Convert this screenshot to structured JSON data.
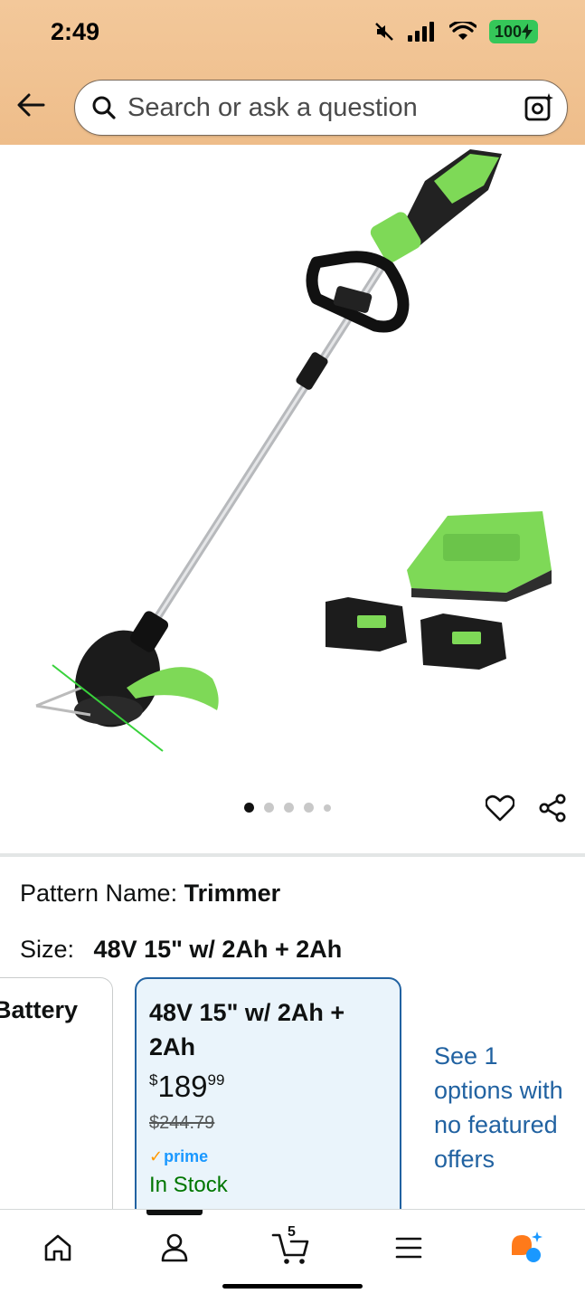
{
  "status_bar": {
    "time": "2:49",
    "battery": "100"
  },
  "header": {
    "search_placeholder": "Search or ask a question"
  },
  "gallery": {
    "dot_count": 5,
    "active_index": 0
  },
  "product": {
    "pattern_label": "Pattern Name:",
    "pattern_value": "Trimmer",
    "size_label": "Size:",
    "size_value": "48V 15\" w/ 2Ah + 2Ah",
    "options": [
      {
        "label": "Battery",
        "partial": true
      },
      {
        "title": "48V 15\" w/ 2Ah + 2Ah",
        "price_symbol": "$",
        "price_whole": "189",
        "price_fraction": "99",
        "list_price": "$244.79",
        "prime_label": "prime",
        "availability": "In Stock",
        "selected": true
      }
    ],
    "see_options_link": "See 1 options with no featured offers"
  },
  "bottom_nav": {
    "cart_count": "5",
    "tabs": [
      "home",
      "account",
      "cart",
      "menu",
      "rufus"
    ]
  },
  "colors": {
    "header_bg": "#f0c290",
    "accent_green": "#7ed957",
    "link_blue": "#2162a1",
    "in_stock_green": "#007600",
    "prime_blue": "#1a98ff"
  }
}
